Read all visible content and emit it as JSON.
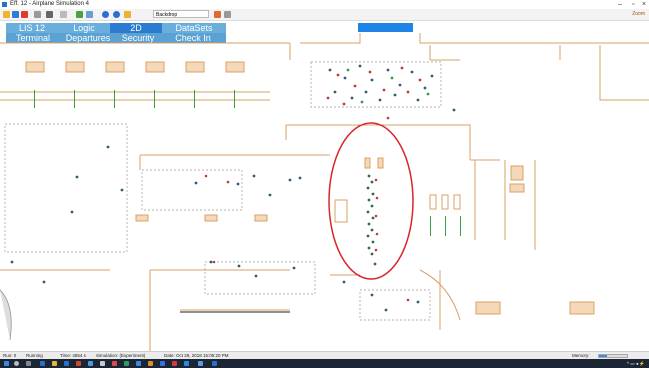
{
  "window": {
    "title": "Eff. 12 - Airplane Simulation 4"
  },
  "toolbar": {
    "combo_value": "Backdrop",
    "right_label": "Zoom"
  },
  "tabs_row1": [
    {
      "label": "LIS 12"
    },
    {
      "label": "Logic"
    },
    {
      "label": "2D"
    },
    {
      "label": "DataSets"
    }
  ],
  "tabs_row2": [
    {
      "label": "Terminal"
    },
    {
      "label": "Departures"
    },
    {
      "label": "Security"
    },
    {
      "label": "Check In"
    }
  ],
  "status": {
    "run": "Run: 0",
    "state": "Running",
    "time": "Time: 4654 s",
    "simulation": "Simulation: (Experiment)",
    "date": "Date: Oct 29, 2018 15:05:20 PM",
    "memory_label": "Memory:",
    "memory_fraction": 0.3
  },
  "colors": {
    "tab_bg": "#6aaedb",
    "tab_active": "#2b7bd0",
    "wall": "#d8a06a",
    "highlight": "#d9262c"
  }
}
